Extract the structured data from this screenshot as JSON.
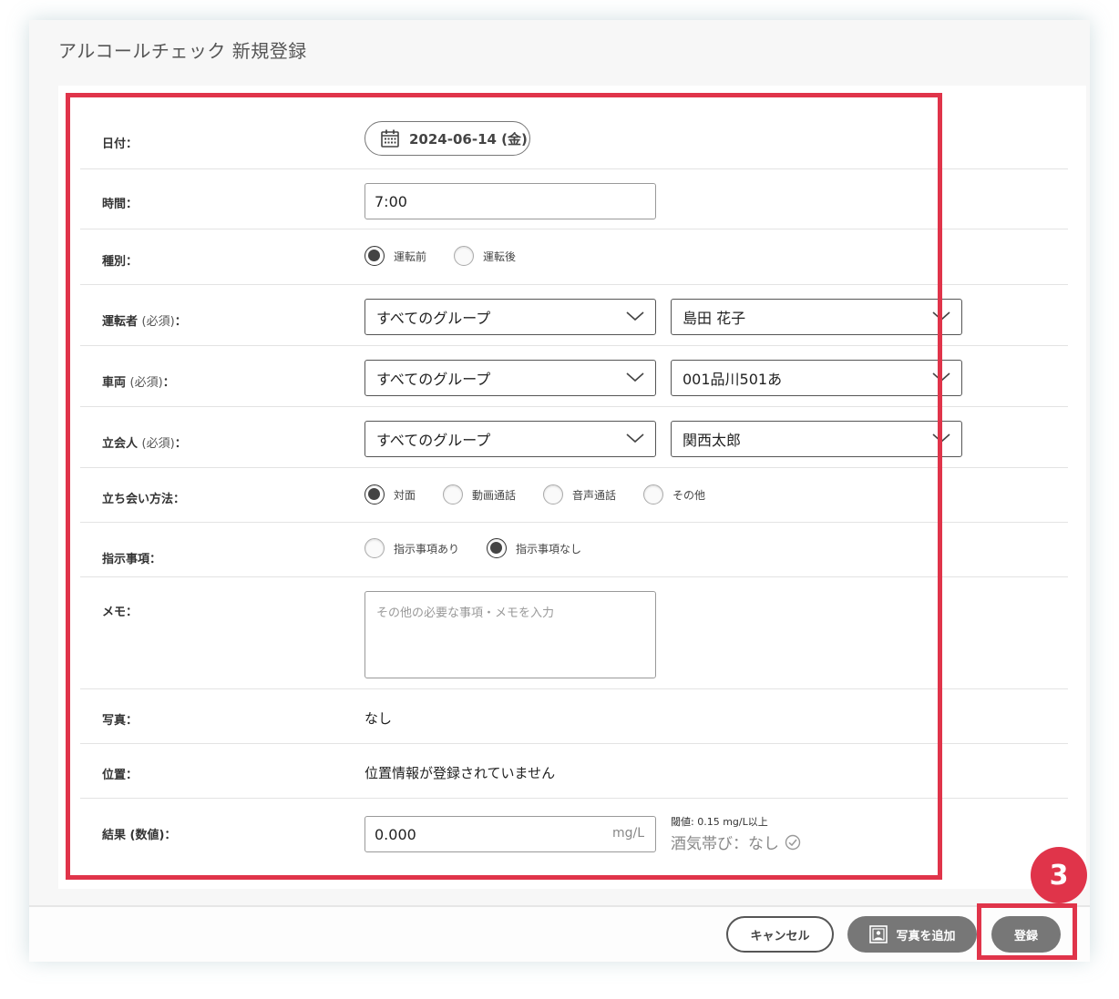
{
  "modal": {
    "title": "アルコールチェック 新規登録"
  },
  "form": {
    "date": {
      "label": "日付：",
      "value": "2024-06-14 (金)"
    },
    "time": {
      "label": "時間：",
      "value": "7:00"
    },
    "type": {
      "label": "種別：",
      "options": [
        "運転前",
        "運転後"
      ],
      "selected": "運転前"
    },
    "driver": {
      "label": "運転者",
      "required": "(必須)",
      "suffix": "：",
      "group": "すべてのグループ",
      "value": "島田 花子"
    },
    "vehicle": {
      "label": "車両",
      "required": "(必須)",
      "suffix": "：",
      "group": "すべてのグループ",
      "value": "001品川501あ"
    },
    "witness": {
      "label": "立会人",
      "required": "(必須)",
      "suffix": "：",
      "group": "すべてのグループ",
      "value": "関西太郎"
    },
    "method": {
      "label": "立ち会い方法：",
      "options": [
        "対面",
        "動画通話",
        "音声通話",
        "その他"
      ],
      "selected": "対面"
    },
    "instructions": {
      "label": "指示事項：",
      "options": [
        "指示事項あり",
        "指示事項なし"
      ],
      "selected": "指示事項なし"
    },
    "memo": {
      "label": "メモ：",
      "placeholder": "その他の必要な事項・メモを入力"
    },
    "photo": {
      "label": "写真：",
      "value": "なし"
    },
    "location": {
      "label": "位置：",
      "value": "位置情報が登録されていません"
    },
    "result": {
      "label": "結果 (数値)：",
      "value": "0.000",
      "unit": "mg/L",
      "threshold": "閾値: 0.15 mg/L以上",
      "status": "酒気帯び：なし"
    }
  },
  "footer": {
    "cancel_label": "キャンセル",
    "add_photo_label": "写真を追加",
    "register_label": "登録"
  },
  "annotation": {
    "step": "3"
  },
  "colors": {
    "highlight": "#e0344a",
    "button_gray": "#777777"
  }
}
